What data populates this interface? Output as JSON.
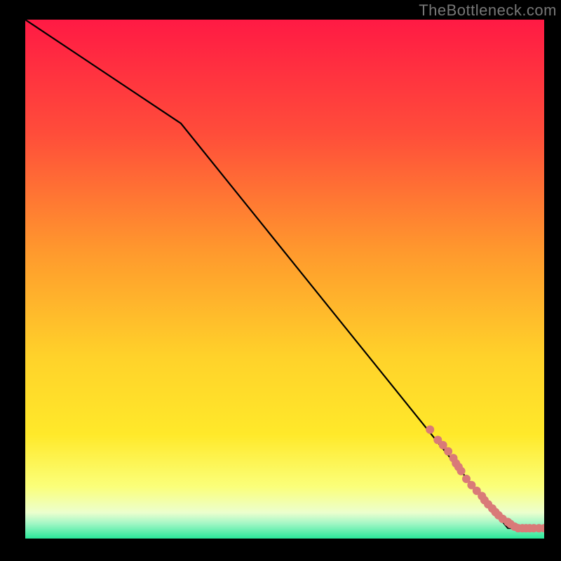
{
  "watermark": "TheBottleneck.com",
  "chart_data": {
    "type": "line",
    "title": "",
    "xlabel": "",
    "ylabel": "",
    "xlim": [
      0,
      100
    ],
    "ylim": [
      0,
      100
    ],
    "background_gradient": {
      "top": "#ff1a44",
      "upper_mid": "#ff8a2b",
      "mid": "#ffe02a",
      "lower_mid": "#faff87",
      "bottom_band": "#2ae89a"
    },
    "series": [
      {
        "name": "curve",
        "type": "line",
        "color": "#000000",
        "x": [
          0,
          30,
          88,
          93,
          100
        ],
        "y": [
          100,
          80,
          8,
          2,
          2
        ]
      },
      {
        "name": "points",
        "type": "scatter",
        "color": "#d97a78",
        "x": [
          78,
          79.5,
          80.5,
          81.5,
          82.5,
          83,
          83.5,
          84,
          85,
          86,
          87,
          88,
          88.5,
          89.2,
          90,
          90.6,
          91.2,
          92,
          93,
          93.5,
          94.3,
          95,
          95.8,
          96.5,
          97.2,
          98,
          99,
          100
        ],
        "y": [
          21,
          19,
          18,
          16.8,
          15.5,
          14.5,
          13.8,
          13,
          11.5,
          10.3,
          9.2,
          8.2,
          7.4,
          6.6,
          5.8,
          5.1,
          4.5,
          3.8,
          3.2,
          2.8,
          2.3,
          2.0,
          2.0,
          2.0,
          2.0,
          2.0,
          2.0,
          2.0
        ]
      }
    ]
  }
}
